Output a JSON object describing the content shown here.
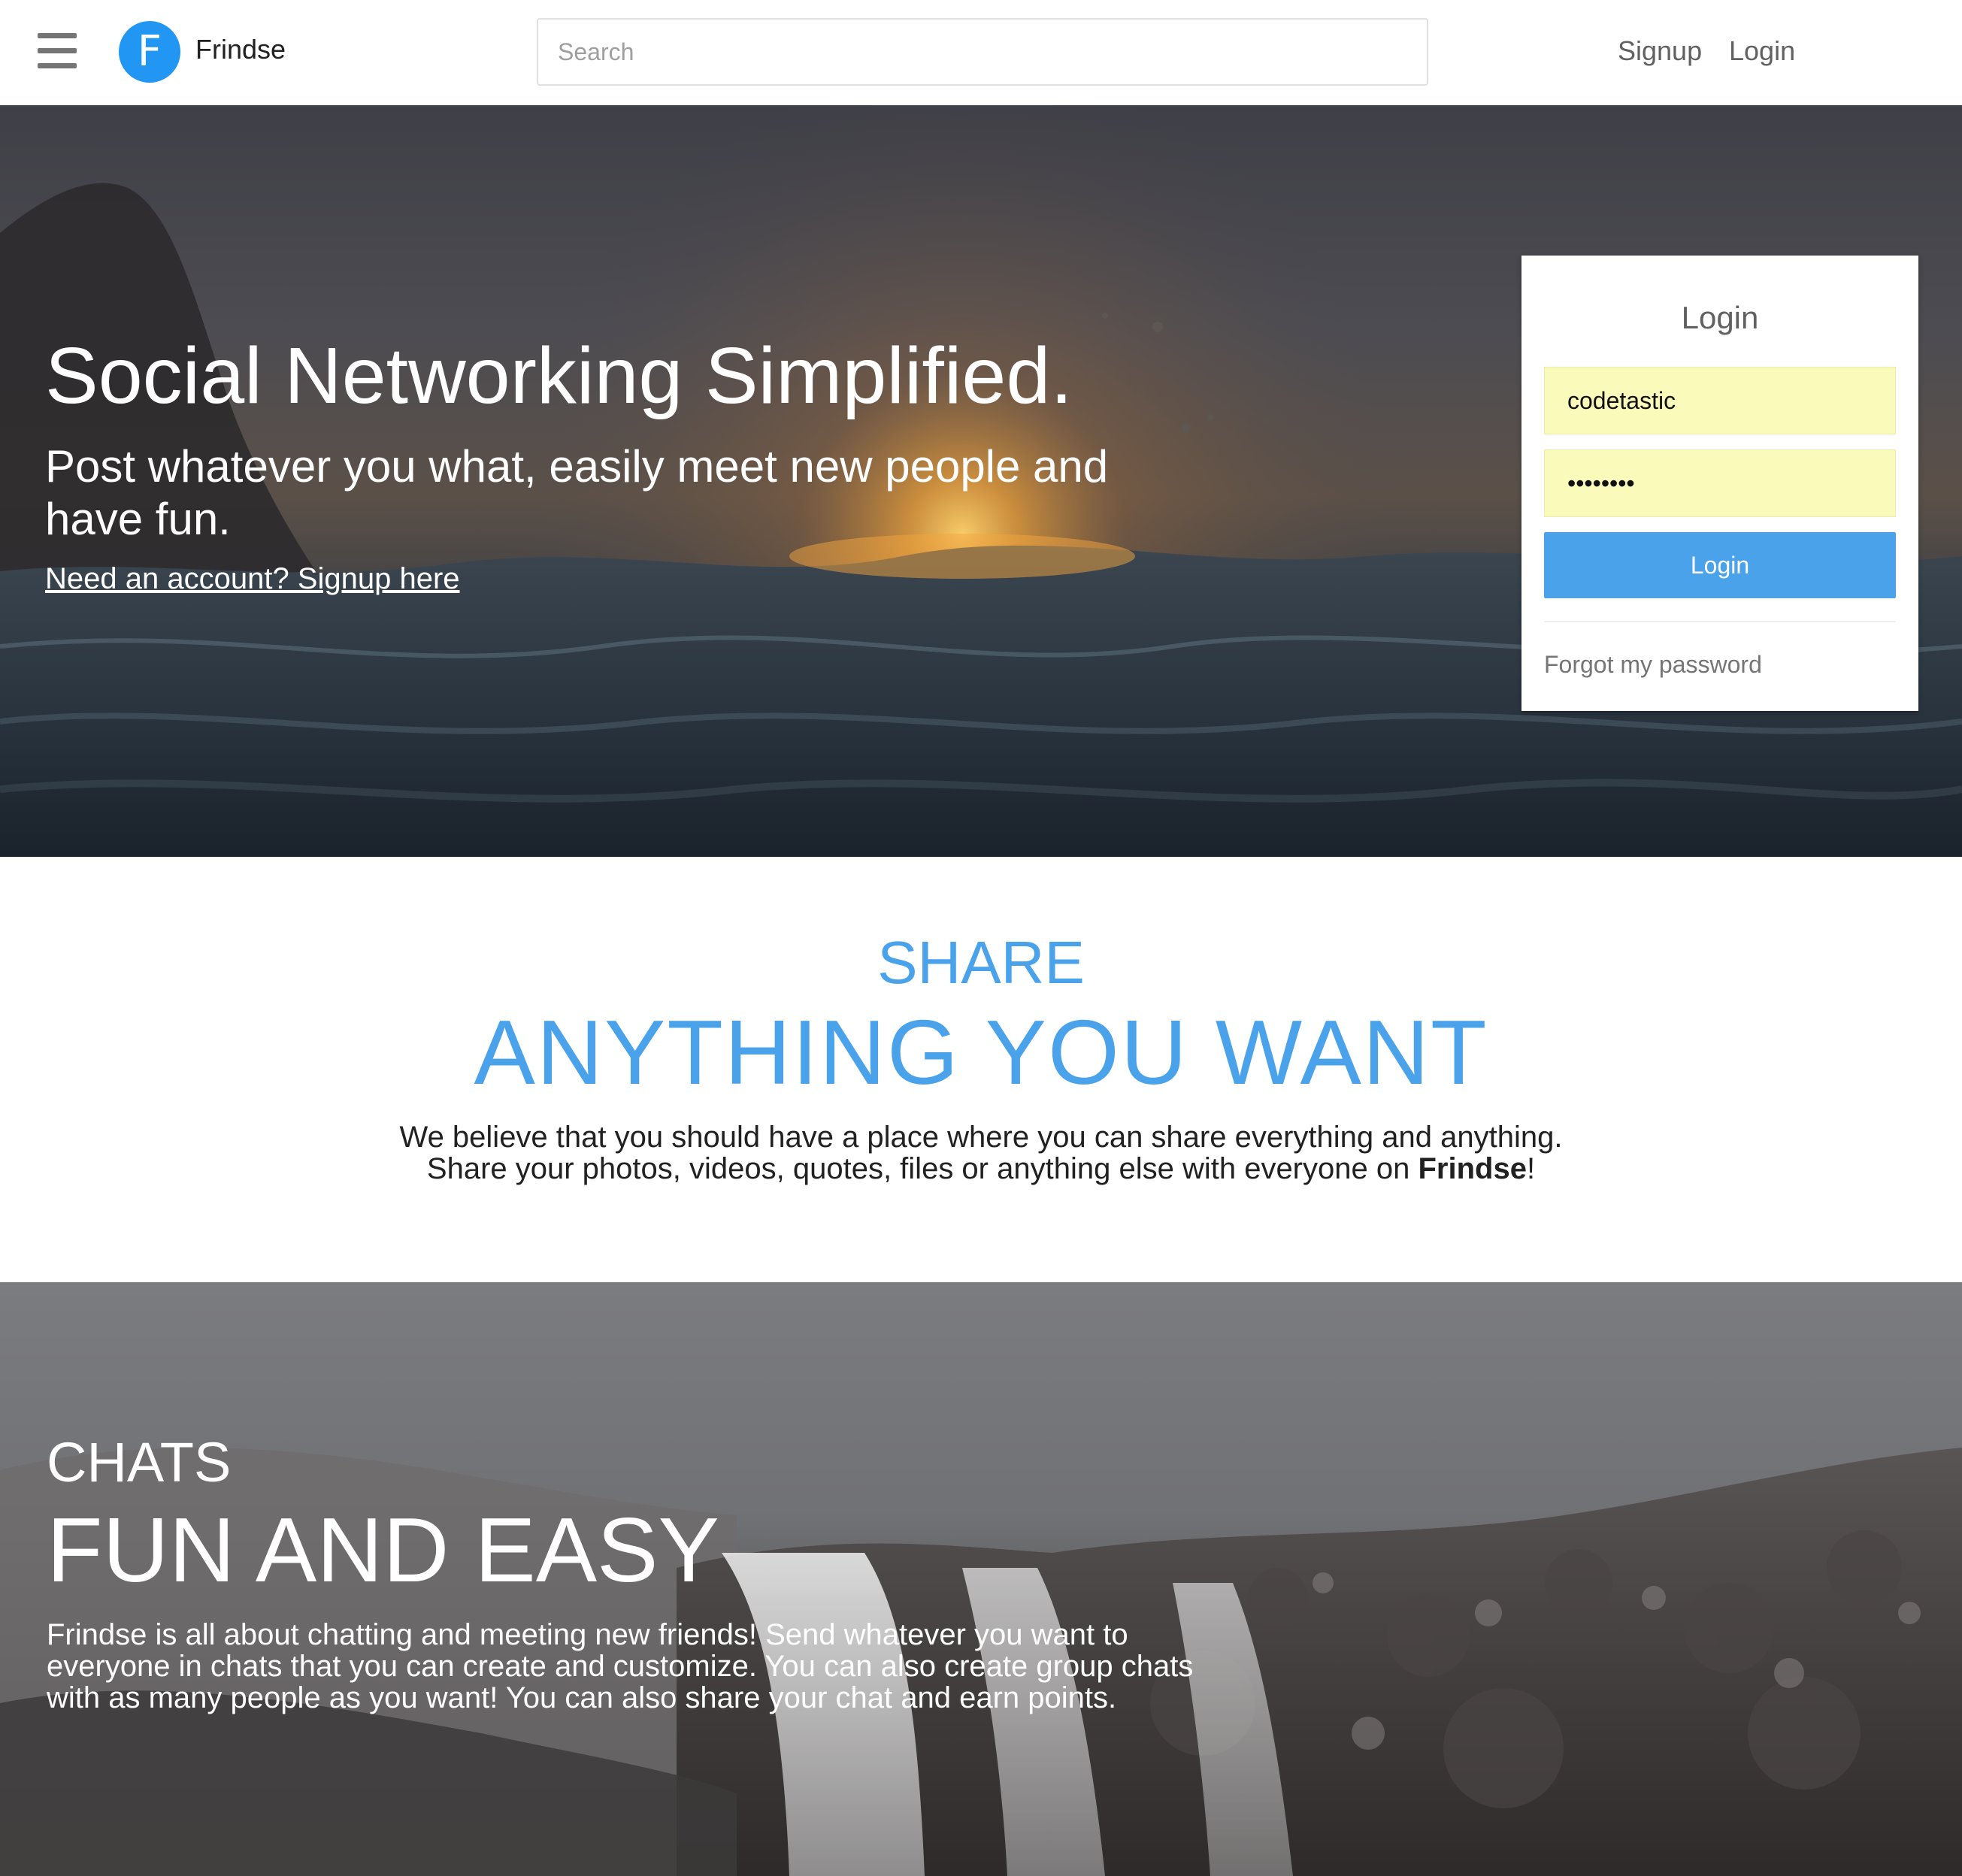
{
  "brand": {
    "logo_letter": "F",
    "name": "Frindse"
  },
  "nav": {
    "search_placeholder": "Search",
    "signup_label": "Signup",
    "login_label": "Login"
  },
  "hero": {
    "title": "Social Networking Simplified.",
    "subtitle": "Post whatever you what, easily meet new people and have fun.",
    "signup_link": "Need an account? Signup here"
  },
  "login_form": {
    "title": "Login",
    "username_value": "codetastic",
    "password_value": "********",
    "submit_label": "Login",
    "forgot_label": "Forgot my password"
  },
  "share": {
    "kicker": "SHARE",
    "heading": "ANYTHING YOU WANT",
    "line1": "We believe that you should have a place where you can share everything and anything.",
    "line2_prefix": "Share your photos, videos, quotes, files or anything else with everyone on ",
    "line2_brand": "Frindse",
    "line2_suffix": "!"
  },
  "chats": {
    "kicker": "CHATS",
    "heading": "FUN AND EASY",
    "text": "Frindse is all about chatting and meeting new friends! Send whatever you want to everyone in chats that you can create and customize. You can also create group chats with as many people as you want! You can also share your chat and earn points."
  },
  "colors": {
    "accent_blue": "#4aa3ea",
    "logo_blue": "#2196f3",
    "autofill_yellow": "#fafbbb"
  },
  "icons": {
    "menu": "hamburger-menu-icon"
  }
}
